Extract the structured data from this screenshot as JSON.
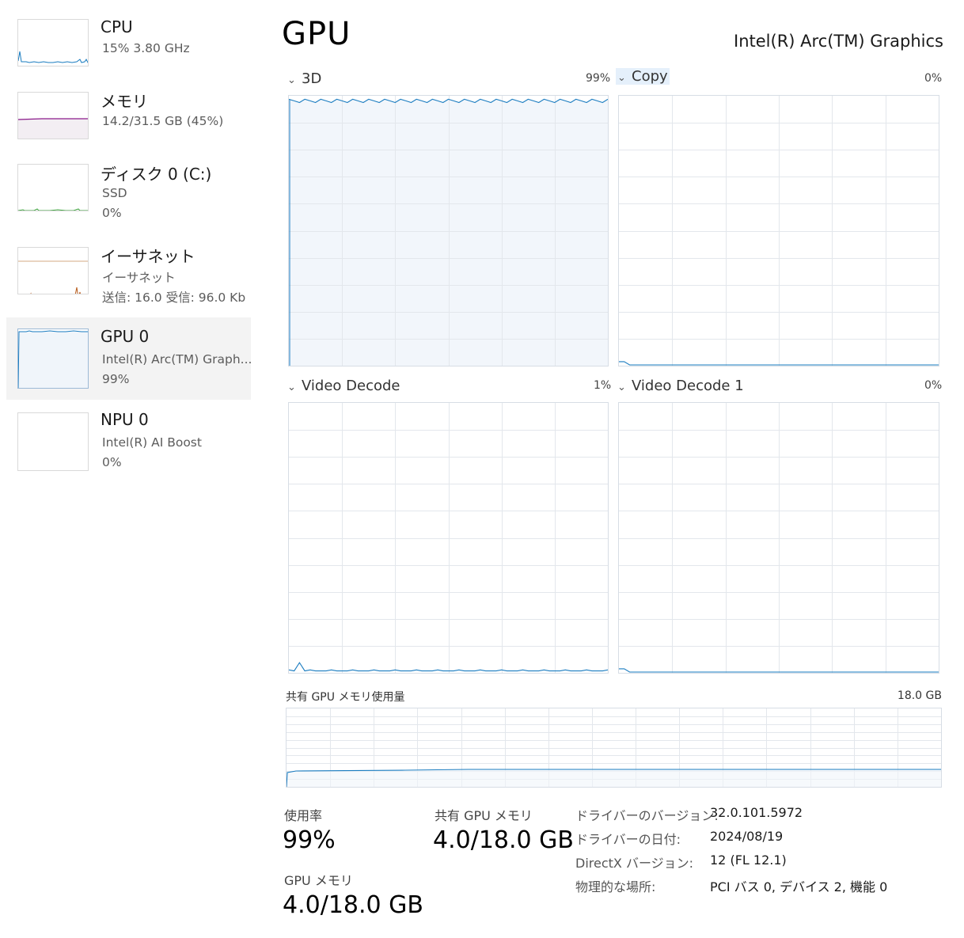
{
  "sidebar": {
    "items": [
      {
        "title": "CPU",
        "sub1": "15%  3.80 GHz",
        "sub2": "",
        "sub3": ""
      },
      {
        "title": "メモリ",
        "sub1": "14.2/31.5 GB (45%)",
        "sub2": "",
        "sub3": ""
      },
      {
        "title": "ディスク 0 (C:)",
        "sub1": "SSD",
        "sub2": "0%",
        "sub3": ""
      },
      {
        "title": "イーサネット",
        "sub1": "イーサネット",
        "sub2": "送信: 16.0  受信: 96.0 Kb",
        "sub3": ""
      },
      {
        "title": "GPU 0",
        "sub1": "Intel(R) Arc(TM) Graph...",
        "sub2": "99%",
        "sub3": ""
      },
      {
        "title": "NPU 0",
        "sub1": "Intel(R) AI Boost",
        "sub2": "0%",
        "sub3": ""
      }
    ]
  },
  "header": {
    "title": "GPU",
    "device": "Intel(R) Arc(TM) Graphics"
  },
  "engines": [
    {
      "label": "3D",
      "percent": "99%",
      "value": 99
    },
    {
      "label": "Copy",
      "percent": "0%",
      "value": 0
    },
    {
      "label": "Video Decode",
      "percent": "1%",
      "value": 1
    },
    {
      "label": "Video Decode 1",
      "percent": "0%",
      "value": 0
    }
  ],
  "shared_memory": {
    "label": "共有 GPU メモリ使用量",
    "max": "18.0 GB"
  },
  "stats": {
    "utilization_label": "使用率",
    "utilization_value": "99%",
    "shared_mem_label": "共有 GPU メモリ",
    "shared_mem_value": "4.0/18.0 GB",
    "gpu_mem_label": "GPU メモリ",
    "gpu_mem_value": "4.0/18.0 GB"
  },
  "info": [
    {
      "key": "ドライバーのバージョン:",
      "value": "32.0.101.5972"
    },
    {
      "key": "ドライバーの日付:",
      "value": "2024/08/19"
    },
    {
      "key": "DirectX バージョン:",
      "value": "12 (FL 12.1)"
    },
    {
      "key": "物理的な場所:",
      "value": "PCI バス 0, デバイス 2, 機能 0"
    }
  ],
  "colors": {
    "gpu_line": "#1a7cc0",
    "gpu_fill": "#f0f5fa",
    "memory_line": "#8b1a8b",
    "disk_line": "#3fa33f",
    "ethernet_line": "#b85c1c",
    "grid": "#e3e7ec"
  }
}
